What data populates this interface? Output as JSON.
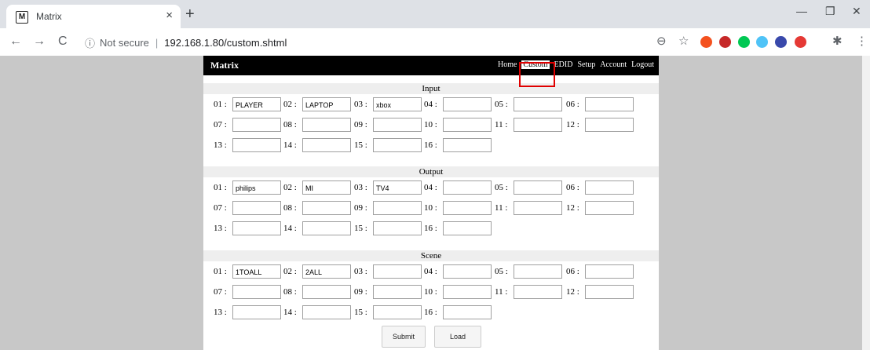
{
  "browser": {
    "tab_title": "Matrix",
    "favicon_letter": "M",
    "tab_close": "×",
    "new_tab": "+",
    "security_text": "Not secure",
    "url": "192.168.1.80/custom.shtml",
    "nav_back": "←",
    "nav_forward": "→",
    "nav_reload": "C",
    "info_icon": "ⓘ",
    "zoom_icon": "⊖",
    "star_icon": "☆",
    "puzzle_icon": "✱",
    "menu_icon": "⋮",
    "win_min": "—",
    "win_restore": "❐",
    "win_close": "✕"
  },
  "page": {
    "brand": "Matrix",
    "nav": [
      "Home",
      "Custom",
      "EDID",
      "Setup",
      "Account",
      "Logout"
    ],
    "active_nav": "Custom",
    "sections": [
      {
        "title": "Input",
        "fields": [
          {
            "num": "01 :",
            "value": "PLAYER"
          },
          {
            "num": "02 :",
            "value": "LAPTOP"
          },
          {
            "num": "03 :",
            "value": "xbox"
          },
          {
            "num": "04 :",
            "value": ""
          },
          {
            "num": "05 :",
            "value": ""
          },
          {
            "num": "06 :",
            "value": ""
          },
          {
            "num": "07 :",
            "value": ""
          },
          {
            "num": "08 :",
            "value": ""
          },
          {
            "num": "09 :",
            "value": ""
          },
          {
            "num": "10 :",
            "value": ""
          },
          {
            "num": "11 :",
            "value": ""
          },
          {
            "num": "12 :",
            "value": ""
          },
          {
            "num": "13 :",
            "value": ""
          },
          {
            "num": "14 :",
            "value": ""
          },
          {
            "num": "15 :",
            "value": ""
          },
          {
            "num": "16 :",
            "value": ""
          }
        ]
      },
      {
        "title": "Output",
        "fields": [
          {
            "num": "01 :",
            "value": "philips"
          },
          {
            "num": "02 :",
            "value": "MI"
          },
          {
            "num": "03 :",
            "value": "TV4"
          },
          {
            "num": "04 :",
            "value": ""
          },
          {
            "num": "05 :",
            "value": ""
          },
          {
            "num": "06 :",
            "value": ""
          },
          {
            "num": "07 :",
            "value": ""
          },
          {
            "num": "08 :",
            "value": ""
          },
          {
            "num": "09 :",
            "value": ""
          },
          {
            "num": "10 :",
            "value": ""
          },
          {
            "num": "11 :",
            "value": ""
          },
          {
            "num": "12 :",
            "value": ""
          },
          {
            "num": "13 :",
            "value": ""
          },
          {
            "num": "14 :",
            "value": ""
          },
          {
            "num": "15 :",
            "value": ""
          },
          {
            "num": "16 :",
            "value": ""
          }
        ]
      },
      {
        "title": "Scene",
        "fields": [
          {
            "num": "01 :",
            "value": "1TOALL"
          },
          {
            "num": "02 :",
            "value": "2ALL"
          },
          {
            "num": "03 :",
            "value": ""
          },
          {
            "num": "04 :",
            "value": ""
          },
          {
            "num": "05 :",
            "value": ""
          },
          {
            "num": "06 :",
            "value": ""
          },
          {
            "num": "07 :",
            "value": ""
          },
          {
            "num": "08 :",
            "value": ""
          },
          {
            "num": "09 :",
            "value": ""
          },
          {
            "num": "10 :",
            "value": ""
          },
          {
            "num": "11 :",
            "value": ""
          },
          {
            "num": "12 :",
            "value": ""
          },
          {
            "num": "13 :",
            "value": ""
          },
          {
            "num": "14 :",
            "value": ""
          },
          {
            "num": "15 :",
            "value": ""
          },
          {
            "num": "16 :",
            "value": ""
          }
        ]
      }
    ],
    "submit_label": "Submit",
    "load_label": "Load"
  },
  "colors": {
    "highlight": "#e00000",
    "topbar": "#000000",
    "extensions": [
      "#f4511e",
      "#c62828",
      "#00c853",
      "#4fc3f7",
      "#3949ab",
      "#e53935"
    ]
  }
}
